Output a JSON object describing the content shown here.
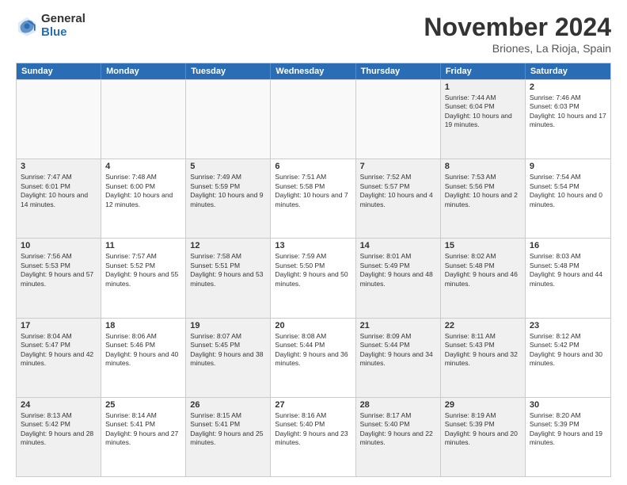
{
  "logo": {
    "general": "General",
    "blue": "Blue"
  },
  "title": "November 2024",
  "location": "Briones, La Rioja, Spain",
  "header_days": [
    "Sunday",
    "Monday",
    "Tuesday",
    "Wednesday",
    "Thursday",
    "Friday",
    "Saturday"
  ],
  "weeks": [
    [
      {
        "day": "",
        "text": "",
        "empty": true
      },
      {
        "day": "",
        "text": "",
        "empty": true
      },
      {
        "day": "",
        "text": "",
        "empty": true
      },
      {
        "day": "",
        "text": "",
        "empty": true
      },
      {
        "day": "",
        "text": "",
        "empty": true
      },
      {
        "day": "1",
        "text": "Sunrise: 7:44 AM\nSunset: 6:04 PM\nDaylight: 10 hours and 19 minutes.",
        "shaded": true
      },
      {
        "day": "2",
        "text": "Sunrise: 7:46 AM\nSunset: 6:03 PM\nDaylight: 10 hours and 17 minutes.",
        "shaded": false
      }
    ],
    [
      {
        "day": "3",
        "text": "Sunrise: 7:47 AM\nSunset: 6:01 PM\nDaylight: 10 hours and 14 minutes.",
        "shaded": true
      },
      {
        "day": "4",
        "text": "Sunrise: 7:48 AM\nSunset: 6:00 PM\nDaylight: 10 hours and 12 minutes.",
        "shaded": false
      },
      {
        "day": "5",
        "text": "Sunrise: 7:49 AM\nSunset: 5:59 PM\nDaylight: 10 hours and 9 minutes.",
        "shaded": true
      },
      {
        "day": "6",
        "text": "Sunrise: 7:51 AM\nSunset: 5:58 PM\nDaylight: 10 hours and 7 minutes.",
        "shaded": false
      },
      {
        "day": "7",
        "text": "Sunrise: 7:52 AM\nSunset: 5:57 PM\nDaylight: 10 hours and 4 minutes.",
        "shaded": true
      },
      {
        "day": "8",
        "text": "Sunrise: 7:53 AM\nSunset: 5:56 PM\nDaylight: 10 hours and 2 minutes.",
        "shaded": true
      },
      {
        "day": "9",
        "text": "Sunrise: 7:54 AM\nSunset: 5:54 PM\nDaylight: 10 hours and 0 minutes.",
        "shaded": false
      }
    ],
    [
      {
        "day": "10",
        "text": "Sunrise: 7:56 AM\nSunset: 5:53 PM\nDaylight: 9 hours and 57 minutes.",
        "shaded": true
      },
      {
        "day": "11",
        "text": "Sunrise: 7:57 AM\nSunset: 5:52 PM\nDaylight: 9 hours and 55 minutes.",
        "shaded": false
      },
      {
        "day": "12",
        "text": "Sunrise: 7:58 AM\nSunset: 5:51 PM\nDaylight: 9 hours and 53 minutes.",
        "shaded": true
      },
      {
        "day": "13",
        "text": "Sunrise: 7:59 AM\nSunset: 5:50 PM\nDaylight: 9 hours and 50 minutes.",
        "shaded": false
      },
      {
        "day": "14",
        "text": "Sunrise: 8:01 AM\nSunset: 5:49 PM\nDaylight: 9 hours and 48 minutes.",
        "shaded": true
      },
      {
        "day": "15",
        "text": "Sunrise: 8:02 AM\nSunset: 5:48 PM\nDaylight: 9 hours and 46 minutes.",
        "shaded": true
      },
      {
        "day": "16",
        "text": "Sunrise: 8:03 AM\nSunset: 5:48 PM\nDaylight: 9 hours and 44 minutes.",
        "shaded": false
      }
    ],
    [
      {
        "day": "17",
        "text": "Sunrise: 8:04 AM\nSunset: 5:47 PM\nDaylight: 9 hours and 42 minutes.",
        "shaded": true
      },
      {
        "day": "18",
        "text": "Sunrise: 8:06 AM\nSunset: 5:46 PM\nDaylight: 9 hours and 40 minutes.",
        "shaded": false
      },
      {
        "day": "19",
        "text": "Sunrise: 8:07 AM\nSunset: 5:45 PM\nDaylight: 9 hours and 38 minutes.",
        "shaded": true
      },
      {
        "day": "20",
        "text": "Sunrise: 8:08 AM\nSunset: 5:44 PM\nDaylight: 9 hours and 36 minutes.",
        "shaded": false
      },
      {
        "day": "21",
        "text": "Sunrise: 8:09 AM\nSunset: 5:44 PM\nDaylight: 9 hours and 34 minutes.",
        "shaded": true
      },
      {
        "day": "22",
        "text": "Sunrise: 8:11 AM\nSunset: 5:43 PM\nDaylight: 9 hours and 32 minutes.",
        "shaded": true
      },
      {
        "day": "23",
        "text": "Sunrise: 8:12 AM\nSunset: 5:42 PM\nDaylight: 9 hours and 30 minutes.",
        "shaded": false
      }
    ],
    [
      {
        "day": "24",
        "text": "Sunrise: 8:13 AM\nSunset: 5:42 PM\nDaylight: 9 hours and 28 minutes.",
        "shaded": true
      },
      {
        "day": "25",
        "text": "Sunrise: 8:14 AM\nSunset: 5:41 PM\nDaylight: 9 hours and 27 minutes.",
        "shaded": false
      },
      {
        "day": "26",
        "text": "Sunrise: 8:15 AM\nSunset: 5:41 PM\nDaylight: 9 hours and 25 minutes.",
        "shaded": true
      },
      {
        "day": "27",
        "text": "Sunrise: 8:16 AM\nSunset: 5:40 PM\nDaylight: 9 hours and 23 minutes.",
        "shaded": false
      },
      {
        "day": "28",
        "text": "Sunrise: 8:17 AM\nSunset: 5:40 PM\nDaylight: 9 hours and 22 minutes.",
        "shaded": true
      },
      {
        "day": "29",
        "text": "Sunrise: 8:19 AM\nSunset: 5:39 PM\nDaylight: 9 hours and 20 minutes.",
        "shaded": true
      },
      {
        "day": "30",
        "text": "Sunrise: 8:20 AM\nSunset: 5:39 PM\nDaylight: 9 hours and 19 minutes.",
        "shaded": false
      }
    ]
  ]
}
